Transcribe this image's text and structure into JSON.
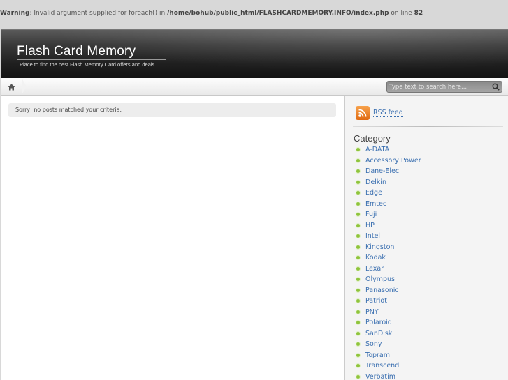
{
  "warning": {
    "label": "Warning",
    "message_prefix": ": Invalid argument supplied for foreach() in ",
    "path": "/home/bohub/public_html/FLASHCARDMEMORY.INFO/index.php",
    "line_prefix": " on line ",
    "line": "82"
  },
  "header": {
    "title": "Flash Card Memory",
    "tagline": "Place to find the best Flash Memory Card offers and deals"
  },
  "navbar": {
    "home_icon": "home-icon",
    "search_placeholder": "Type text to search here...",
    "search_icon": "magnifier-icon"
  },
  "main": {
    "notice": "Sorry, no posts matched your criteria."
  },
  "sidebar": {
    "rss_label": "RSS feed",
    "category_title": "Category",
    "categories": [
      "A-DATA",
      "Accessory Power",
      "Dane-Elec",
      "Delkin",
      "Edge",
      "Emtec",
      "Fuji",
      "HP",
      "Intel",
      "Kingston",
      "Kodak",
      "Lexar",
      "Olympus",
      "Panasonic",
      "Patriot",
      "PNY",
      "Polaroid",
      "SanDisk",
      "Sony",
      "Topram",
      "Transcend",
      "Verbatim"
    ]
  },
  "colors": {
    "link": "#3a6fb0",
    "bullet": "#8fc43c",
    "rss": "#e97a1e",
    "header_bg": "#1f1f1f"
  }
}
